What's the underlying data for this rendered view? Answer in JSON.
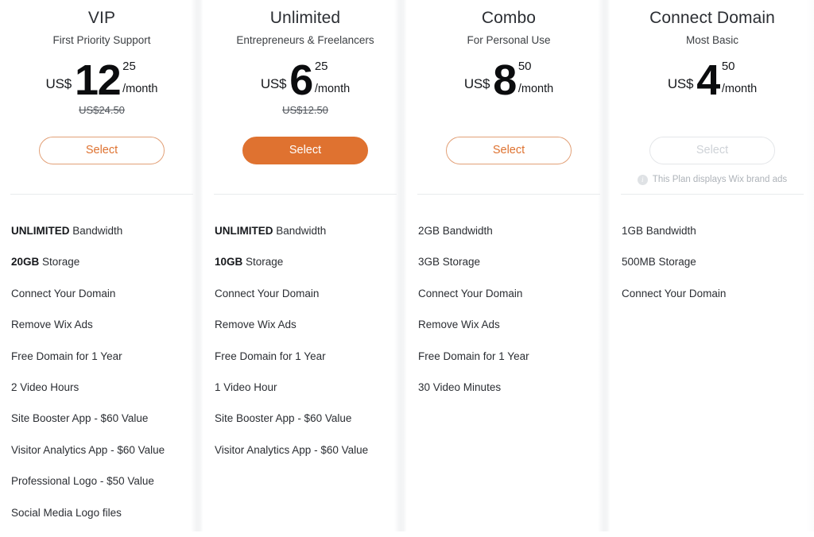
{
  "colors": {
    "accent_orange": "#df7230",
    "accent_orange_border": "#e2a077",
    "disabled_grey": "#ced2d7",
    "text_primary": "#2b2e33",
    "divider": "#e9ebed",
    "page_background": "#ffffff"
  },
  "plans": [
    {
      "name": "VIP",
      "tagline": "First Priority Support",
      "currency": "US$",
      "price_major": "12",
      "price_cents": "25",
      "period": "/month",
      "original_price": "US$24.50",
      "select_label": "Select",
      "button_style": "outline",
      "note": "",
      "features": [
        {
          "bold": "UNLIMITED",
          "rest": " Bandwidth"
        },
        {
          "bold": "20GB",
          "rest": " Storage"
        },
        {
          "bold": "",
          "rest": "Connect Your Domain"
        },
        {
          "bold": "",
          "rest": "Remove Wix Ads"
        },
        {
          "bold": "",
          "rest": "Free Domain for 1 Year"
        },
        {
          "bold": "",
          "rest": "2 Video Hours"
        },
        {
          "bold": "",
          "rest": "Site Booster App - $60 Value"
        },
        {
          "bold": "",
          "rest": "Visitor Analytics App - $60 Value"
        },
        {
          "bold": "",
          "rest": "Professional Logo - $50 Value"
        },
        {
          "bold": "",
          "rest": "Social Media Logo files"
        }
      ]
    },
    {
      "name": "Unlimited",
      "tagline": "Entrepreneurs & Freelancers",
      "currency": "US$",
      "price_major": "6",
      "price_cents": "25",
      "period": "/month",
      "original_price": "US$12.50",
      "select_label": "Select",
      "button_style": "primary",
      "note": "",
      "features": [
        {
          "bold": "UNLIMITED",
          "rest": " Bandwidth"
        },
        {
          "bold": "10GB",
          "rest": " Storage"
        },
        {
          "bold": "",
          "rest": "Connect Your Domain"
        },
        {
          "bold": "",
          "rest": "Remove Wix Ads"
        },
        {
          "bold": "",
          "rest": "Free Domain for 1 Year"
        },
        {
          "bold": "",
          "rest": "1 Video Hour"
        },
        {
          "bold": "",
          "rest": "Site Booster App - $60 Value"
        },
        {
          "bold": "",
          "rest": "Visitor Analytics App - $60 Value"
        }
      ]
    },
    {
      "name": "Combo",
      "tagline": "For Personal Use",
      "currency": "US$",
      "price_major": "8",
      "price_cents": "50",
      "period": "/month",
      "original_price": "",
      "select_label": "Select",
      "button_style": "outline",
      "note": "",
      "features": [
        {
          "bold": "",
          "rest": "2GB Bandwidth"
        },
        {
          "bold": "",
          "rest": "3GB Storage"
        },
        {
          "bold": "",
          "rest": "Connect Your Domain"
        },
        {
          "bold": "",
          "rest": "Remove Wix Ads"
        },
        {
          "bold": "",
          "rest": "Free Domain for 1 Year"
        },
        {
          "bold": "",
          "rest": "30 Video Minutes"
        }
      ]
    },
    {
      "name": "Connect Domain",
      "tagline": "Most Basic",
      "currency": "US$",
      "price_major": "4",
      "price_cents": "50",
      "period": "/month",
      "original_price": "",
      "select_label": "Select",
      "button_style": "disabled",
      "note": "This Plan displays Wix brand ads",
      "note_icon": "info-icon",
      "features": [
        {
          "bold": "",
          "rest": "1GB Bandwidth"
        },
        {
          "bold": "",
          "rest": "500MB Storage"
        },
        {
          "bold": "",
          "rest": "Connect Your Domain"
        }
      ]
    }
  ]
}
